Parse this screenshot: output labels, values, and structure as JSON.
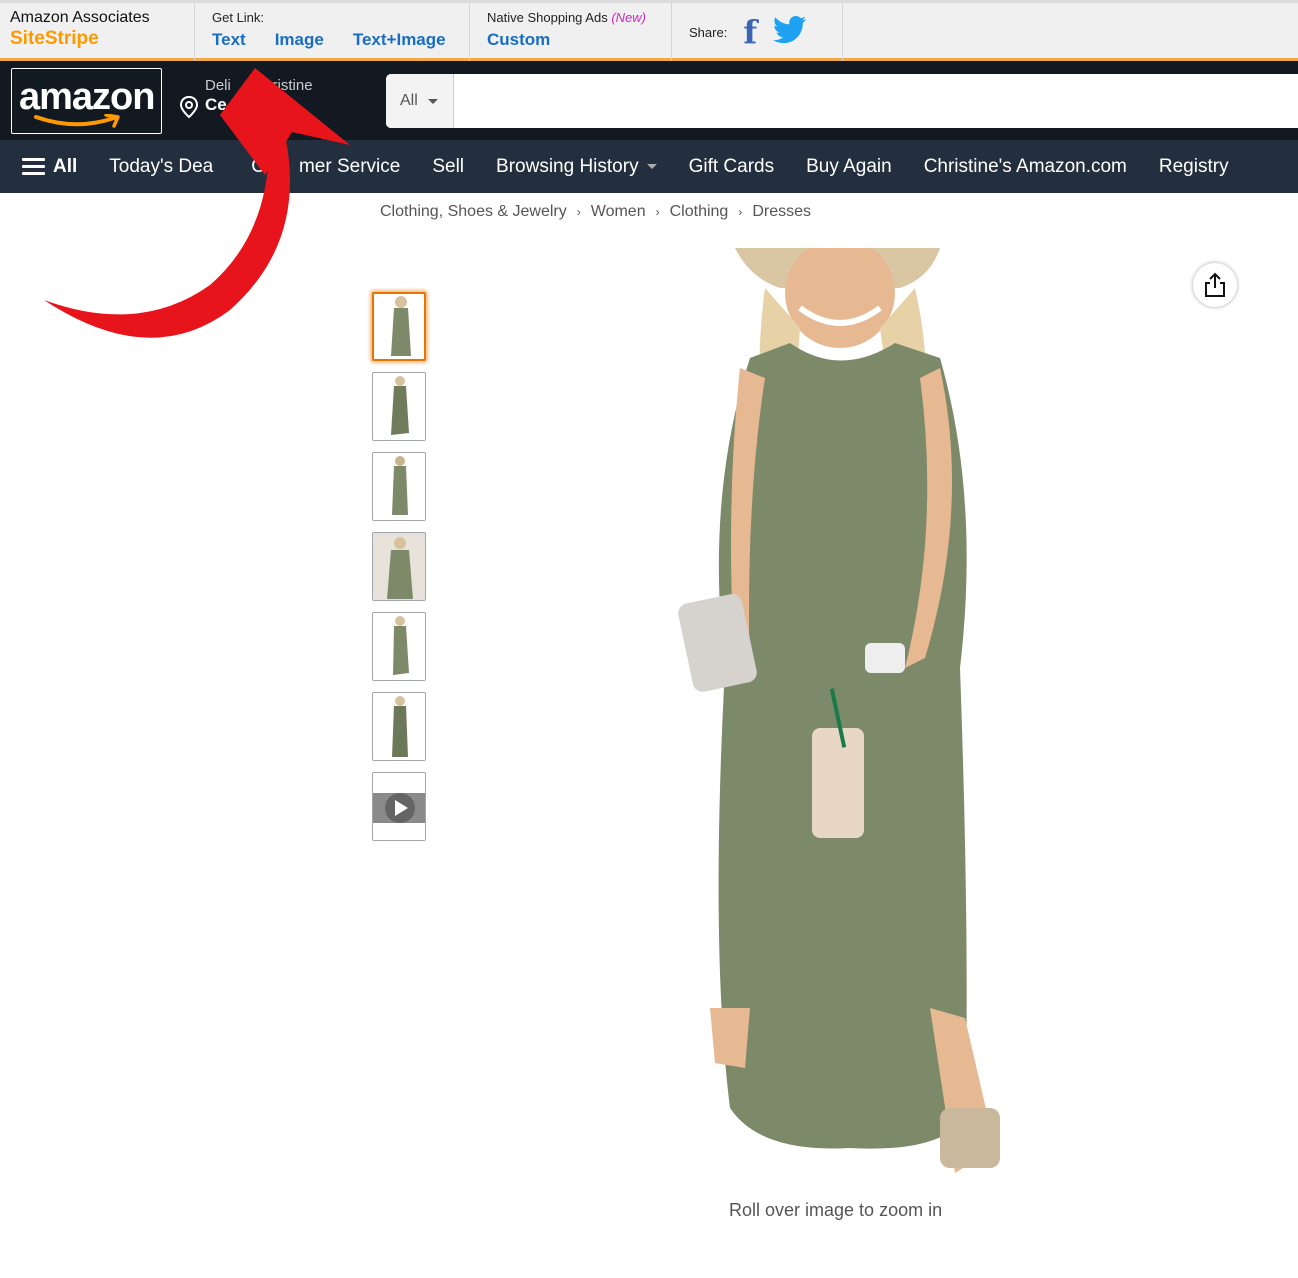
{
  "sitestripe": {
    "brand_line1": "Amazon Associates",
    "brand_line2": "SiteStripe",
    "get_link_label": "Get Link:",
    "links": [
      "Text",
      "Image",
      "Text+Image"
    ],
    "native_label": "Native Shopping Ads",
    "native_new": "(New)",
    "native_link": "Custom",
    "share_label": "Share:",
    "facebook_icon": "f"
  },
  "header": {
    "logo": "amazon",
    "deliver_line1": "Deli        hristine",
    "deliver_line2": "Ce",
    "search_category": "All",
    "search_placeholder": ""
  },
  "nav": {
    "all": "All",
    "items": [
      "Today's Dea",
      "C",
      "mer Service",
      "Sell",
      "Browsing History",
      "Gift Cards",
      "Buy Again",
      "Christine's Amazon.com",
      "Registry"
    ]
  },
  "breadcrumb": [
    "Clothing, Shoes & Jewelry",
    "Women",
    "Clothing",
    "Dresses"
  ],
  "product": {
    "rollover_text": "Roll over image to zoom in",
    "thumbnail_count": 7,
    "dress_color": "#7d8a6a"
  },
  "colors": {
    "accent": "#ff9900",
    "link": "#1a6ec2",
    "header_bg": "#131921",
    "nav_bg": "#232f3e",
    "annotation_arrow": "#e8141b"
  }
}
